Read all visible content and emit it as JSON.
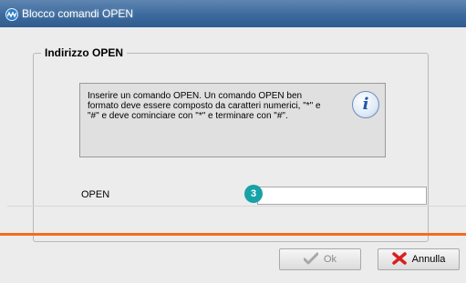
{
  "window": {
    "title": "Blocco comandi OPEN",
    "icon": "app-logo-icon"
  },
  "group": {
    "title": "Indirizzo OPEN"
  },
  "info": {
    "text_lines": [
      "Inserire un comando OPEN. Un comando OPEN ben",
      "formato deve essere composto da caratteri numerici, \"*\" e",
      "\"#\" e deve cominciare con \"*\" e terminare con \"#\"."
    ],
    "icon": "info-icon",
    "icon_glyph": "i"
  },
  "field": {
    "label": "OPEN",
    "value": "",
    "badge": "3"
  },
  "buttons": {
    "ok_label": "Ok",
    "ok_icon": "checkmark-icon",
    "cancel_label": "Annulla",
    "cancel_icon": "red-x-icon"
  },
  "colors": {
    "accent_orange": "#f26d21",
    "badge_teal": "#17a2a8",
    "titlebar_blue": "#3f6c9f"
  }
}
